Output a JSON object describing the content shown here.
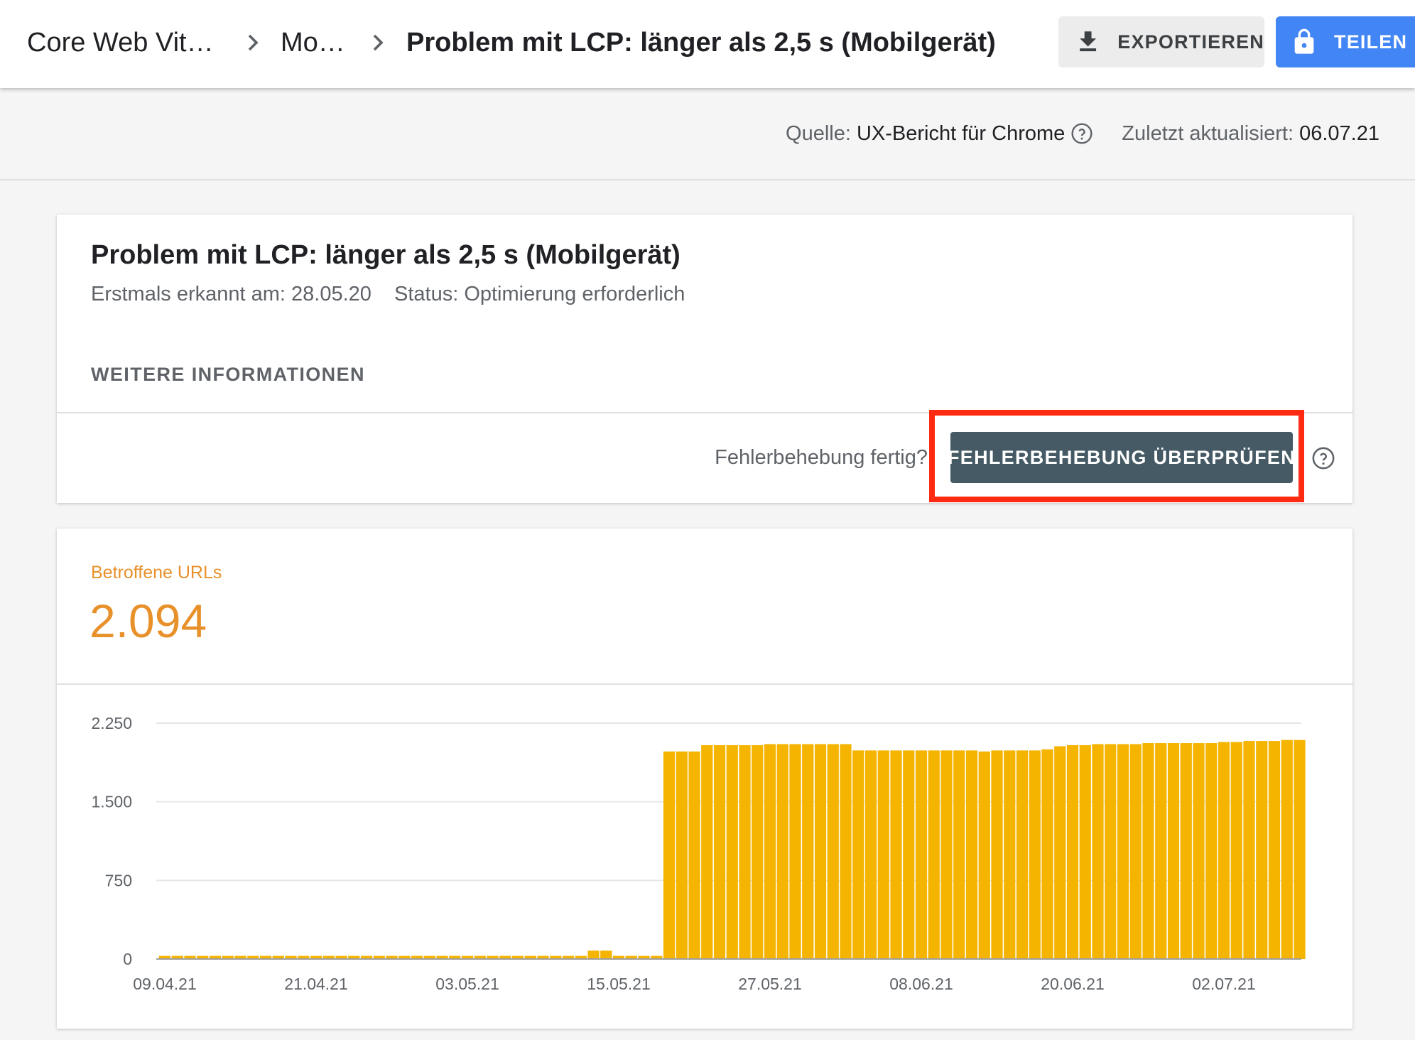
{
  "header": {
    "breadcrumb": [
      {
        "label": "Core Web Vit…"
      },
      {
        "label": "Mo…"
      },
      {
        "label": "Problem mit LCP: länger als 2,5 s (Mobilgerät)"
      }
    ],
    "export_label": "EXPORTIEREN",
    "share_label": "TEILEN",
    "accent_color": "#4285f4"
  },
  "info": {
    "source_prefix": "Quelle:",
    "source_value": "UX-Bericht für Chrome",
    "updated_prefix": "Zuletzt aktualisiert:",
    "updated_value": "06.07.21"
  },
  "issue": {
    "title": "Problem mit LCP: länger als 2,5 s (Mobilgerät)",
    "first_detected": "Erstmals erkannt am: 28.05.20",
    "status": "Status: Optimierung erforderlich",
    "more_info": "WEITERE INFORMATIONEN",
    "fix_question": "Fehlerbehebung fertig?",
    "validate_label": "FEHLERBEHEBUNG ÜBERPRÜFEN",
    "highlight_color": "#ff2a12"
  },
  "metric": {
    "label": "Betroffene URLs",
    "value": "2.094",
    "color": "#e8912b"
  },
  "chart_data": {
    "type": "bar",
    "bar_color": "#f4b400",
    "ylim": [
      0,
      2250
    ],
    "yticks": [
      {
        "value": 0,
        "label": "0"
      },
      {
        "value": 750,
        "label": "750"
      },
      {
        "value": 1500,
        "label": "1.500"
      },
      {
        "value": 2250,
        "label": "2.250"
      }
    ],
    "xticks": [
      {
        "index": 0,
        "label": "09.04.21"
      },
      {
        "index": 12,
        "label": "21.04.21"
      },
      {
        "index": 24,
        "label": "03.05.21"
      },
      {
        "index": 36,
        "label": "15.05.21"
      },
      {
        "index": 48,
        "label": "27.05.21"
      },
      {
        "index": 60,
        "label": "08.06.21"
      },
      {
        "index": 72,
        "label": "20.06.21"
      },
      {
        "index": 84,
        "label": "02.07.21"
      }
    ],
    "values": [
      30,
      30,
      30,
      30,
      30,
      30,
      30,
      30,
      30,
      30,
      30,
      30,
      30,
      30,
      30,
      30,
      30,
      30,
      30,
      30,
      30,
      30,
      30,
      30,
      30,
      30,
      30,
      30,
      30,
      30,
      30,
      30,
      30,
      30,
      80,
      80,
      30,
      30,
      30,
      30,
      1980,
      1980,
      1980,
      2040,
      2040,
      2040,
      2040,
      2040,
      2050,
      2050,
      2050,
      2050,
      2050,
      2050,
      2050,
      1990,
      1990,
      1990,
      1990,
      1990,
      1990,
      1990,
      1990,
      1990,
      1990,
      1980,
      1990,
      1990,
      1990,
      1990,
      2000,
      2030,
      2040,
      2040,
      2050,
      2050,
      2050,
      2050,
      2060,
      2060,
      2060,
      2060,
      2060,
      2060,
      2070,
      2070,
      2080,
      2080,
      2080,
      2090,
      2090
    ]
  }
}
